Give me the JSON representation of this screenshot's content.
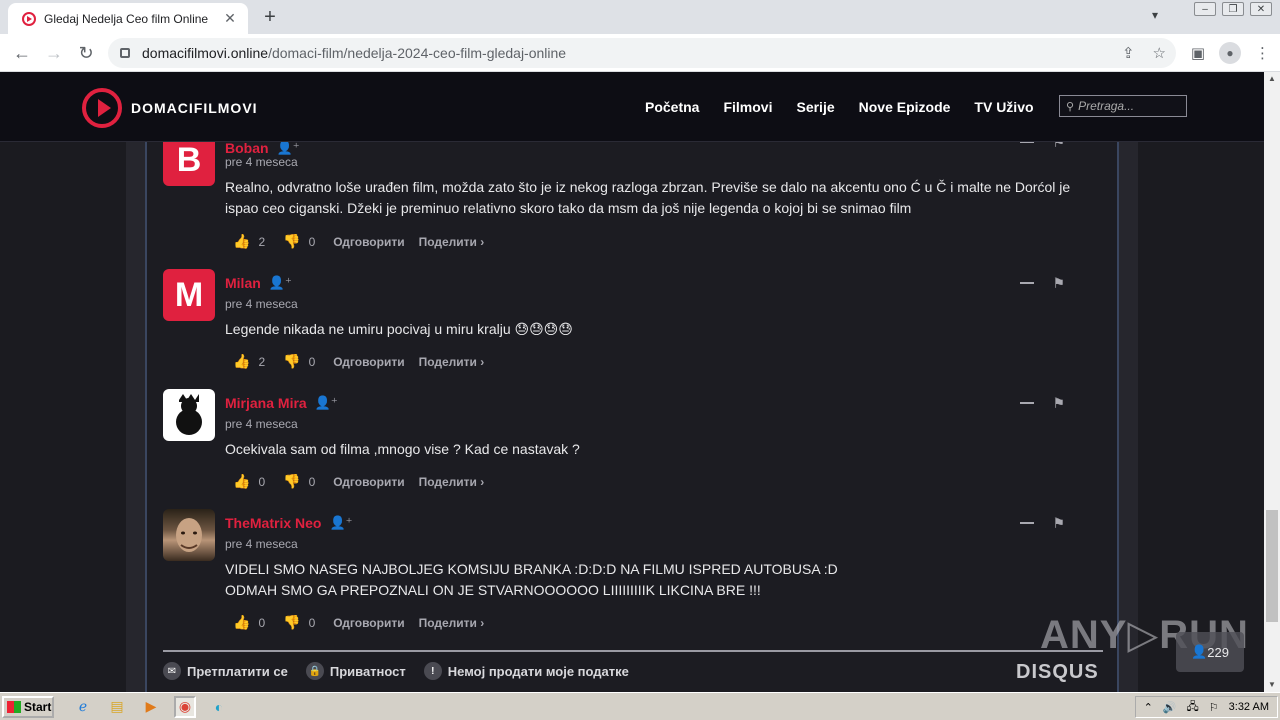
{
  "browser": {
    "tab_title": "Gledaj Nedelja Ceo film Online",
    "tab_close": "✕",
    "new_tab": "+",
    "url_domain": "domacifilmovi.online",
    "url_path": "/domaci-film/nedelja-2024-ceo-film-gledaj-online"
  },
  "site": {
    "logo_text": "DOMACIFILMOVI",
    "nav": [
      "Početna",
      "Filmovi",
      "Serije",
      "Nove Epizode",
      "TV Uživo"
    ],
    "search_placeholder": "Pretraga..."
  },
  "comments": [
    {
      "avatar_letter": "B",
      "author": "Boban",
      "time": "pre 4 meseca",
      "text": "Realno, odvratno loše urađen film, možda zato što je iz nekog razloga zbrzan. Previše se dalo na akcentu ono Ć u Č i malte ne Dorćol je ispao ceo ciganski. Džeki je preminuo relativno skoro tako da msm da još nije legenda o kojoj bi se snimao film",
      "likes": "2",
      "dislikes": "0"
    },
    {
      "avatar_letter": "M",
      "author": "Milan",
      "time": "pre 4 meseca",
      "text": "Legende nikada ne umiru pocivaj u miru kralju 😓😓😓😓",
      "likes": "2",
      "dislikes": "0"
    },
    {
      "avatar_letter": "",
      "author": "Mirjana Mira",
      "time": "pre 4 meseca",
      "text": "Ocekivala sam od filma ,mnogo vise ? Kad ce nastavak ?",
      "likes": "0",
      "dislikes": "0"
    },
    {
      "avatar_letter": "",
      "author": "TheMatrix Neo",
      "time": "pre 4 meseca",
      "text_lines": [
        "VIDELI SMO NASEG NAJBOLJEG KOMSIJU BRANKA :D:D:D NA FILMU ISPRED AUTOBUSA :D",
        "ODMAH SMO GA PREPOZNALI ON JE STVARNOOOOOO LIIIIIIIIIK LIKCINA BRE !!!"
      ],
      "likes": "0",
      "dislikes": "0"
    }
  ],
  "comment_actions": {
    "reply": "Одговорити",
    "share": "Поделити ›"
  },
  "disqus_footer": {
    "subscribe": "Претплатити се",
    "privacy": "Приватност",
    "do_not_sell": "Немој продати моје податке",
    "logo": "DISQUS"
  },
  "overlay": {
    "watermark": "ANY▷RUN",
    "viewer_count": "229"
  },
  "taskbar": {
    "start": "Start",
    "clock": "3:32 AM"
  },
  "colors": {
    "accent": "#e0213f",
    "background": "#1c1c22"
  }
}
